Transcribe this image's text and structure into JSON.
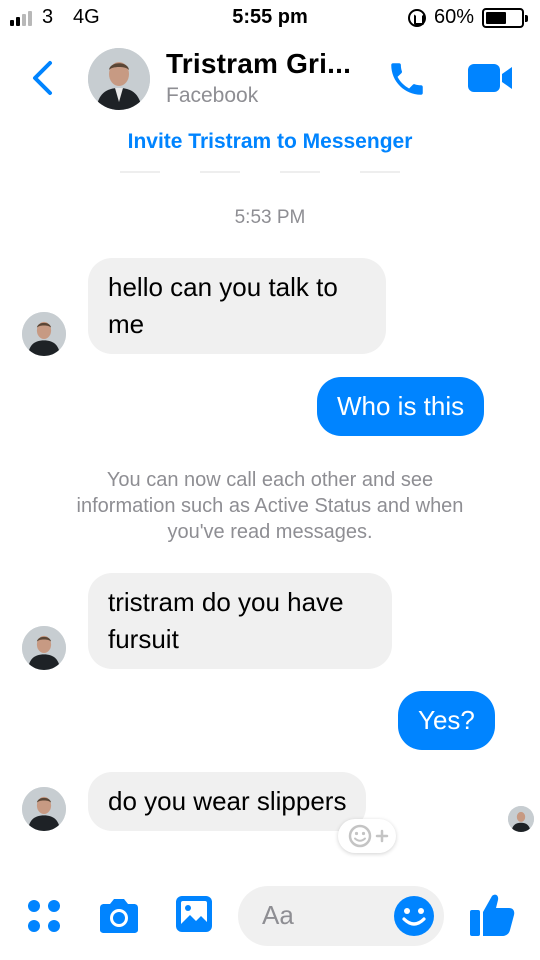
{
  "status_bar": {
    "carrier": "3",
    "network": "4G",
    "time": "5:55 pm",
    "battery_percent": "60%",
    "battery_level": 0.6,
    "signal_bars_filled": 2
  },
  "header": {
    "contact_name": "Tristram Gri...",
    "contact_subtitle": "Facebook",
    "invite_text": "Invite Tristram to Messenger"
  },
  "chat": {
    "timestamp": "5:53 PM",
    "messages": [
      {
        "direction": "in",
        "text": "hello can you talk to me"
      },
      {
        "direction": "out",
        "text": "Who is this"
      },
      {
        "direction": "in",
        "text": "tristram do you have fursuit"
      },
      {
        "direction": "out",
        "text": "Yes?"
      },
      {
        "direction": "in",
        "text": "do you wear slippers"
      }
    ],
    "info_line_1": "You can now call each other and see",
    "info_line_2": "information such as Active Status and when",
    "info_line_3": "you've read messages."
  },
  "composer": {
    "placeholder": "Aa"
  },
  "colors": {
    "accent": "#0084ff",
    "incoming_bubble": "#f0f0f0",
    "muted_text": "#8e8e93"
  },
  "icons": [
    "back-icon",
    "phone-icon",
    "video-camera-icon",
    "menu-dots-icon",
    "camera-icon",
    "gallery-icon",
    "emoji-icon",
    "thumbs-up-icon",
    "add-reaction-icon"
  ]
}
